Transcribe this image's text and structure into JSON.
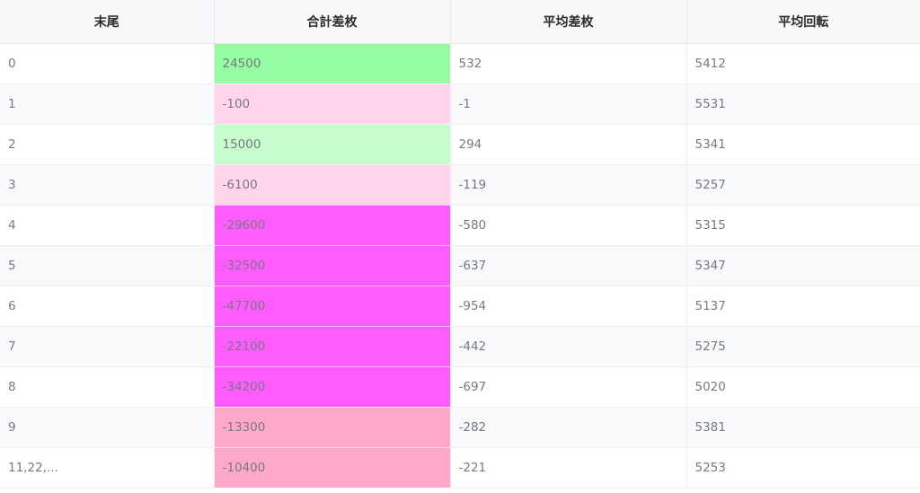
{
  "table": {
    "headers": [
      "末尾",
      "合計差枚",
      "平均差枚",
      "平均回転"
    ],
    "rows": [
      {
        "tail": "0",
        "total": "24500",
        "avg_diff": "532",
        "avg_spin": "5412",
        "total_color": "#96fca4"
      },
      {
        "tail": "1",
        "total": "-100",
        "avg_diff": "-1",
        "avg_spin": "5531",
        "total_color": "#ffd4ec"
      },
      {
        "tail": "2",
        "total": "15000",
        "avg_diff": "294",
        "avg_spin": "5341",
        "total_color": "#c5fdce"
      },
      {
        "tail": "3",
        "total": "-6100",
        "avg_diff": "-119",
        "avg_spin": "5257",
        "total_color": "#ffd4ec"
      },
      {
        "tail": "4",
        "total": "-29600",
        "avg_diff": "-580",
        "avg_spin": "5315",
        "total_color": "#ff5cff"
      },
      {
        "tail": "5",
        "total": "-32500",
        "avg_diff": "-637",
        "avg_spin": "5347",
        "total_color": "#ff5cff"
      },
      {
        "tail": "6",
        "total": "-47700",
        "avg_diff": "-954",
        "avg_spin": "5137",
        "total_color": "#ff5cff"
      },
      {
        "tail": "7",
        "total": "-22100",
        "avg_diff": "-442",
        "avg_spin": "5275",
        "total_color": "#ff5cff"
      },
      {
        "tail": "8",
        "total": "-34200",
        "avg_diff": "-697",
        "avg_spin": "5020",
        "total_color": "#ff5cff"
      },
      {
        "tail": "9",
        "total": "-13300",
        "avg_diff": "-282",
        "avg_spin": "5381",
        "total_color": "#ffa8cc"
      },
      {
        "tail": "11,22,...",
        "total": "-10400",
        "avg_diff": "-221",
        "avg_spin": "5253",
        "total_color": "#ffa8cc"
      }
    ]
  }
}
